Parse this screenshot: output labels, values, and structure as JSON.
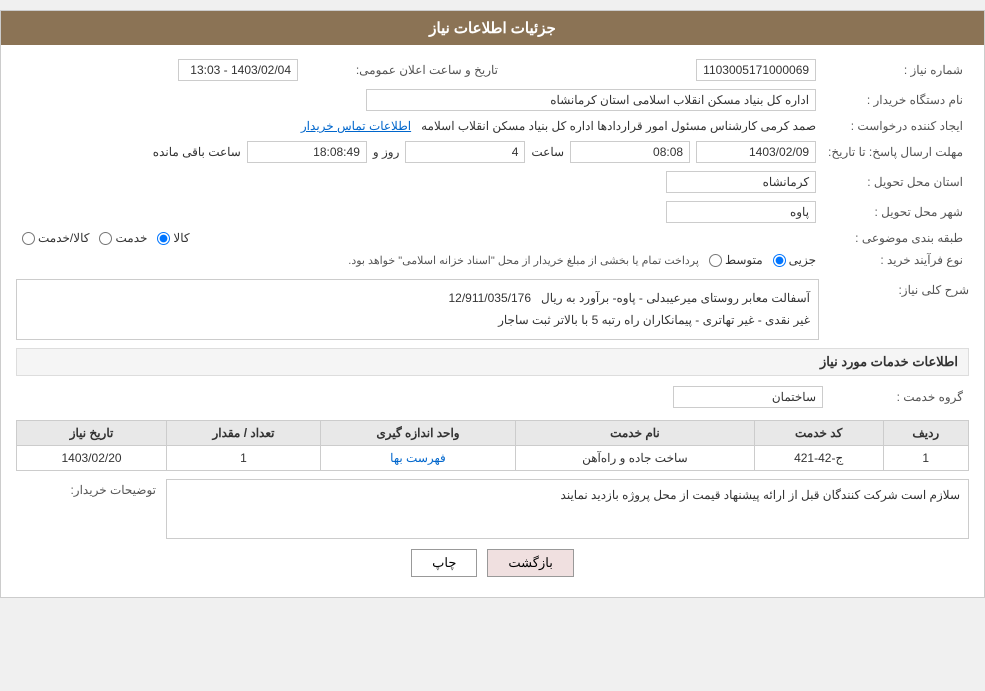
{
  "header": {
    "title": "جزئیات اطلاعات نیاز"
  },
  "fields": {
    "shomareNiaz_label": "شماره نیاز :",
    "shomareNiaz_value": "1103005171000069",
    "namDastgah_label": "نام دستگاه خریدار :",
    "namDastgah_value": "اداره کل بنیاد مسکن انقلاب اسلامی استان کرمانشاه",
    "ijadKonande_label": "ایجاد کننده درخواست :",
    "ijadKonande_value": "صمد کرمی کارشناس مسئول امور قراردادها اداره کل بنیاد مسکن انقلاب اسلامه",
    "tamas_link": "اطلاعات تماس خریدار",
    "tarikhErsalPasokh_label": "مهلت ارسال پاسخ: تا تاریخ:",
    "tarikhPasokh": "1403/02/09",
    "saatPasokh": "08:08",
    "rooz": "4",
    "saat_remaining": "18:08:49",
    "saat_label": "ساعت",
    "rooz_label": "روز و",
    "remaining_label": "ساعت باقی مانده",
    "tarikhElan_label": "تاریخ و ساعت اعلان عمومی:",
    "tarikhElan_value": "1403/02/04 - 13:03",
    "ostan_label": "استان محل تحویل :",
    "ostan_value": "کرمانشاه",
    "shahr_label": "شهر محل تحویل :",
    "shahr_value": "پاوه",
    "tabaqebandi_label": "طبقه بندی موضوعی :",
    "radio_kala": "کالا",
    "radio_khadamat": "خدمت",
    "radio_kalaKhadamat": "کالا/خدمت",
    "farayand_label": "نوع فرآیند خرید :",
    "radio_jozi": "جزیی",
    "radio_motevaset": "متوسط",
    "farayand_note": "پرداخت تمام یا بخشی از مبلغ خریدار از محل \"اسناد خزانه اسلامی\" خواهد بود.",
    "sharhKoli_label": "شرح کلی نیاز:",
    "sharhKoli_value": "آسفالت معابر روستای میرعیبدلی - پاوه- برآورد به ریال  12/911/035/176\nغیر نقدی - غیر تهاتری - پیمانکاران راه رتبه 5 با بالاتر ثبت ساجار",
    "khadamatTitle": "اطلاعات خدمات مورد نیاز",
    "groupeKhadamat_label": "گروه خدمت :",
    "groupeKhadamat_value": "ساختمان",
    "table": {
      "headers": [
        "ردیف",
        "کد خدمت",
        "نام خدمت",
        "واحد اندازه گیری",
        "تعداد / مقدار",
        "تاریخ نیاز"
      ],
      "rows": [
        {
          "radif": "1",
          "kodKhadamat": "ج-42-421",
          "namKhadamat": "ساخت جاده و راه‌آهن",
          "vahed": "فهرست بها",
          "tedad": "1",
          "tarikh": "1403/02/20"
        }
      ]
    },
    "tosihKharidar_label": "توضیحات خریدار:",
    "tosihKharidar_value": "سلازم است شرکت کنندگان قبل از ارائه پیشنهاد قیمت از محل پروژه بازدید نمایند",
    "btn_print": "چاپ",
    "btn_back": "بازگشت"
  }
}
